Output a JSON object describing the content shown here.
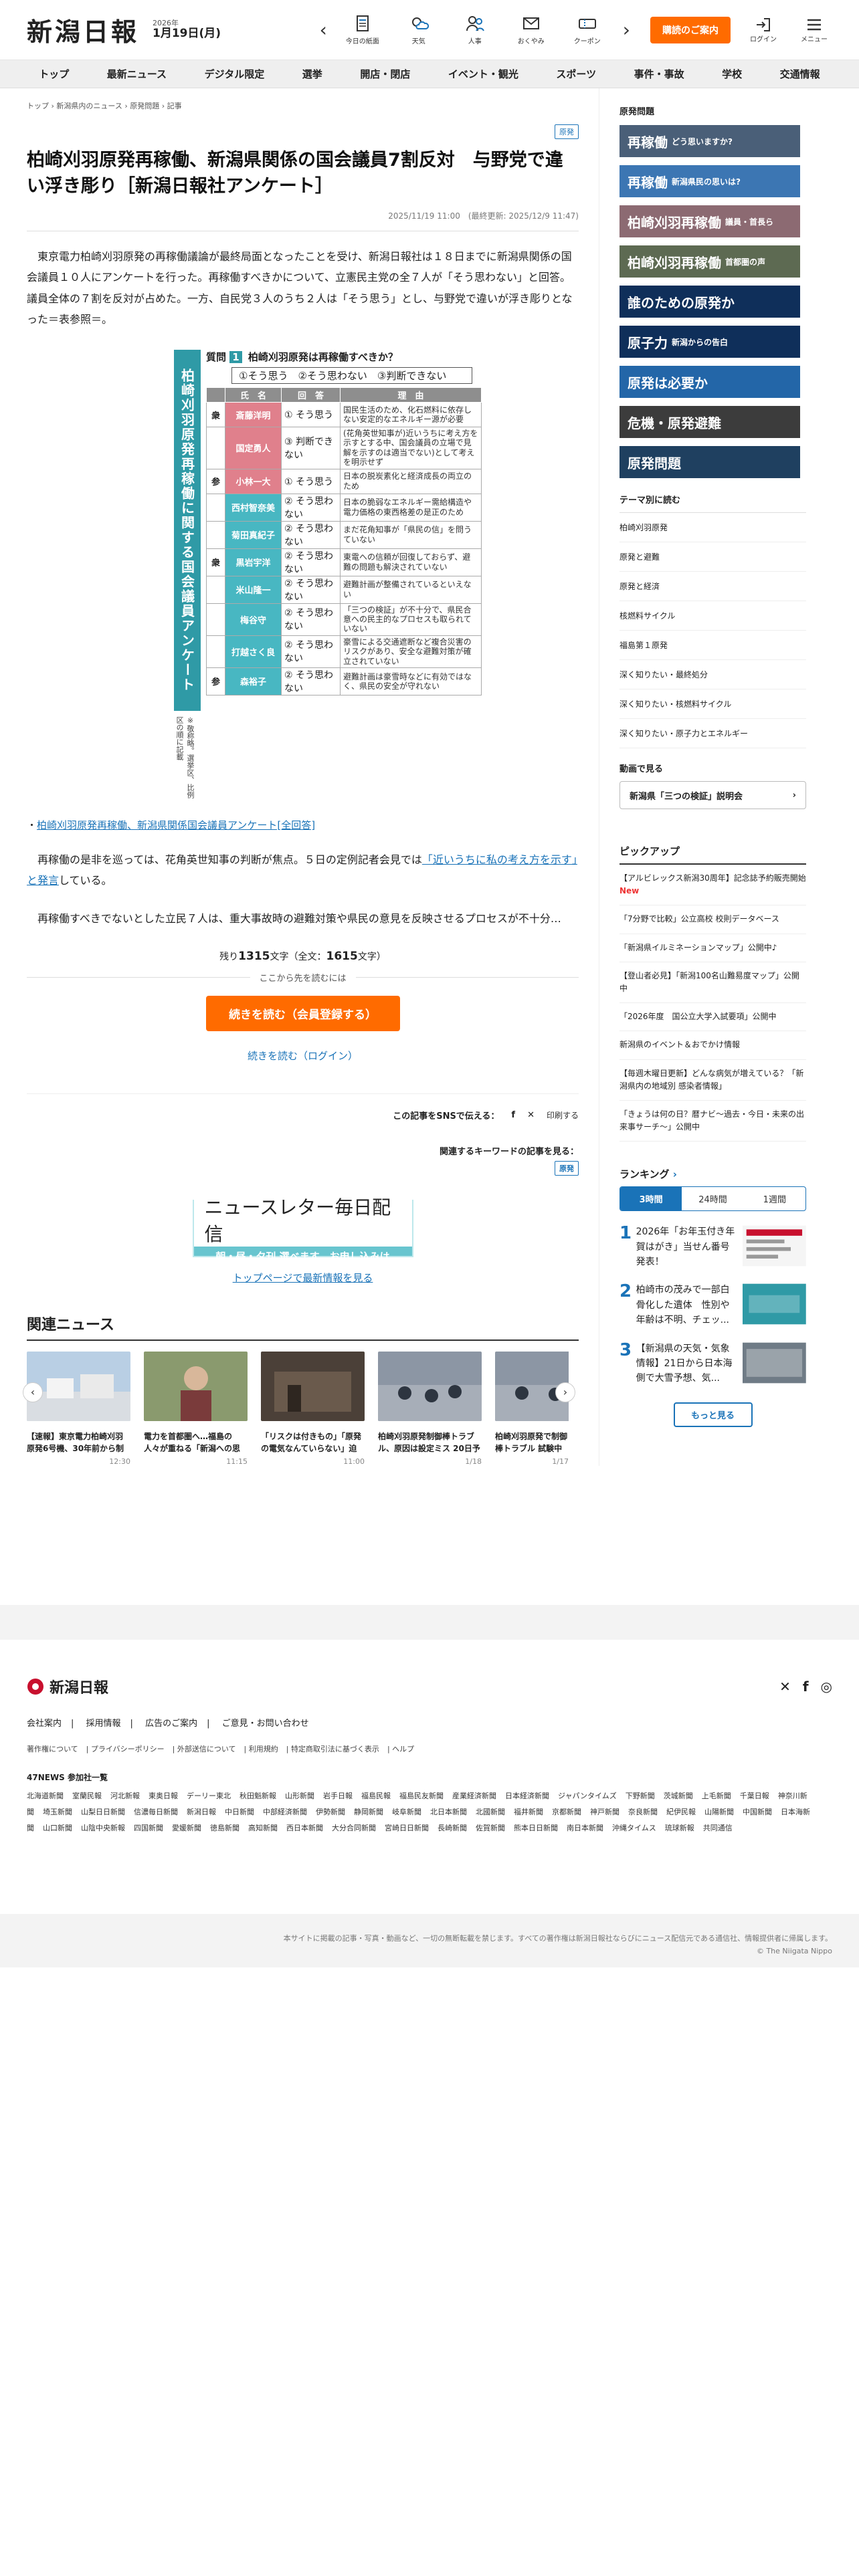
{
  "header": {
    "logo": "新潟日報",
    "year": "2026年",
    "date": "1月19日(月)",
    "icons": [
      "今日の紙面",
      "天気",
      "人事",
      "おくやみ",
      "クーポン"
    ],
    "subscribe": "購読のご案内",
    "login": "ログイン",
    "menu": "メニュー"
  },
  "nav": [
    "トップ",
    "最新ニュース",
    "デジタル限定",
    "選挙",
    "開店・閉店",
    "イベント・観光",
    "スポーツ",
    "事件・事故",
    "学校",
    "交通情報"
  ],
  "breadcrumb": "トップ › 新潟県内のニュース › 原発問題 › 記事",
  "article": {
    "tag": "原発",
    "headline": "柏崎刈羽原発再稼働、新潟県関係の国会議員7割反対　与野党で違い浮き彫り［新潟日報社アンケート］",
    "dateline": "2025/11/19 11:00　(最終更新: 2025/12/9 11:47)",
    "lead": "東京電力柏崎刈羽原発の再稼働議論が最終局面となったことを受け、新潟日報社は１８日までに新潟県関係の国会議員１０人にアンケートを行った。再稼働すべきかについて、立憲民主党の全７人が「そう思わない」と回答。議員全体の７割を反対が占めた。一方、自民党３人のうち２人は「そう思う」とし、与野党で違いが浮き彫りとなった＝表参照＝。",
    "figure": {
      "vertical_title": "柏崎刈羽原発再稼働に関する国会議員アンケート",
      "note": "※敬称略。選挙区、比例区の順に記載",
      "question_no": "1",
      "question": "柏崎刈羽原発は再稼働すべきか？",
      "options": "①そう思う　②そう思わない　③判断できない",
      "headers": [
        "氏　名",
        "回　答",
        "理　由"
      ],
      "rows": [
        {
          "party": "衆",
          "name": "斎藤洋明",
          "answer": "① そう思う",
          "reason": "国民生活のため、化石燃料に依存しない安定的なエネルギー源が必要"
        },
        {
          "party": "",
          "name": "国定勇人",
          "answer": "③ 判断できない",
          "reason": "(花角英世知事が)近いうちに考え方を示すとする中、国会議員の立場で見解を示すのは適当でない)として考えを明示せず"
        },
        {
          "party": "参",
          "name": "小林一大",
          "answer": "① そう思う",
          "reason": "日本の脱炭素化と経済成長の両立のため"
        },
        {
          "party": "",
          "name": "西村智奈美",
          "answer": "② そう思わない",
          "reason": "日本の脆弱なエネルギー需給構造や電力価格の東西格差の是正のため"
        },
        {
          "party": "",
          "name": "菊田真紀子",
          "answer": "② そう思わない",
          "reason": "まだ花角知事が「県民の信」を問うていない"
        },
        {
          "party": "衆",
          "name": "黒岩宇洋",
          "answer": "② そう思わない",
          "reason": "東電への信頼が回復しておらず、避難の問題も解決されていない"
        },
        {
          "party": "",
          "name": "米山隆一",
          "answer": "② そう思わない",
          "reason": "避難計画が整備されているといえない"
        },
        {
          "party": "",
          "name": "梅谷守",
          "answer": "② そう思わない",
          "reason": "「三つの検証」が不十分で、県民合意への民主的なプロセスも取られていない"
        },
        {
          "party": "",
          "name": "打越さく良",
          "answer": "② そう思わない",
          "reason": "豪雪による交通遮断など複合災害のリスクがあり、安全な避難対策が確立されていない"
        },
        {
          "party": "参",
          "name": "森裕子",
          "answer": "② そう思わない",
          "reason": "避難計画は豪雪時などに有効ではなく、県民の安全が守れない"
        }
      ]
    },
    "related_link": "柏崎刈羽原発再稼働、新潟県関係国会議員アンケート[全回答]",
    "para2_pre": "再稼働の是非を巡っては、花角英世知事の判断が焦点。５日の定例記者会見では",
    "para2_link": "「近いうちに私の考え方を示す」と発言",
    "para2_post": "している。",
    "para3": "再稼働すべきでないとした立民７人は、重大事故時の避難対策や県民の意見を反映させるプロセスが不十分…",
    "remain_prefix": "残り",
    "remain_count": "1315",
    "remain_unit": "文字（全文：",
    "total_count": "1615",
    "total_unit": "文字）",
    "continue_text": "ここから先を読むには",
    "btn_member": "続きを読む（会員登録する）",
    "btn_login": "続きを読む（ログイン）",
    "share_label": "この記事をSNSで伝える：",
    "print": "印刷する",
    "keyword_label": "関連するキーワードの記事を見る：",
    "keyword_tag": "原発",
    "newsletter_1": "ニュースレター毎日配信",
    "newsletter_2": "朝・昼・夕刊 選べます　お申し込みは",
    "toplink": "トップページで最新情報を見る"
  },
  "related": {
    "title": "関連ニュース",
    "items": [
      {
        "text": "【速報】東京電力柏崎刈羽原発6号機、30年前から制御棒の警報...",
        "time": "12:30"
      },
      {
        "text": "電力を首都圏へ…福島の人々が重ねる「新潟への思い」 原発事故...",
        "time": "11:15"
      },
      {
        "text": "「リスクは付きもの」「原発の電気なんていらない」迫る再稼働、...",
        "time": "11:00"
      },
      {
        "text": "柏崎刈羽原発制御棒トラブル、原因は設定ミス 20日予定の再稼...",
        "time": "1/18"
      },
      {
        "text": "柏崎刈羽原発で制御棒トラブル 試験中の警報鳴らず、原因不明 ...",
        "time": "1/17"
      }
    ]
  },
  "sidebar": {
    "issue_title": "原発問題",
    "banners": [
      {
        "main": "再稼働",
        "sub": "どう思いますか?"
      },
      {
        "main": "再稼働",
        "sub": "新潟県民の思いは?"
      },
      {
        "main": "柏崎刈羽再稼働",
        "sub": "議員・首長ら"
      },
      {
        "main": "柏崎刈羽再稼働",
        "sub": "首都圏の声"
      },
      {
        "main": "誰のための原発か",
        "sub": ""
      },
      {
        "main": "原子力",
        "sub": "新潟からの告白"
      },
      {
        "main": "原発は必要か",
        "sub": ""
      },
      {
        "main": "危機・原発避難",
        "sub": ""
      },
      {
        "main": "原発問題",
        "sub": ""
      }
    ],
    "theme_title": "テーマ別に読む",
    "themes": [
      "柏崎刈羽原発",
      "原発と避難",
      "原発と経済",
      "核燃料サイクル",
      "福島第１原発",
      "深く知りたい・最終処分",
      "深く知りたい・核燃料サイクル",
      "深く知りたい・原子力とエネルギー"
    ],
    "video_title": "動画で見る",
    "video_btn": "新潟県「三つの検証」説明会",
    "pick_title": "ピックアップ",
    "picks": [
      {
        "text": "【アルビレックス新潟30周年】記念誌予約販売開始",
        "new": "New"
      },
      {
        "text": "「7分野で比較」公立高校 校則データベース",
        "new": ""
      },
      {
        "text": "「新潟県イルミネーションマップ」公開中♪",
        "new": ""
      },
      {
        "text": "【登山者必見】「新潟100名山難易度マップ」公開中",
        "new": ""
      },
      {
        "text": "「2026年度　国公立大学入試要項」公開中",
        "new": ""
      },
      {
        "text": "新潟県のイベント＆おでかけ情報",
        "new": ""
      },
      {
        "text": "【毎週木曜日更新】どんな病気が増えている？「新潟県内の地域別 感染者情報」",
        "new": ""
      },
      {
        "text": "「きょうは何の日？暦ナビ〜過去・今日・未来の出来事サーチ〜」公開中",
        "new": ""
      }
    ],
    "rank_title": "ランキング",
    "rank_tabs": [
      "3時間",
      "24時間",
      "1週間"
    ],
    "rankings": [
      {
        "no": "1",
        "text": "2026年「お年玉付き年賀はがき」当せん番号発表！"
      },
      {
        "no": "2",
        "text": "柏崎市の茂みで一部白骨化した遺体　性別や年齢は不明、チェッ..."
      },
      {
        "no": "3",
        "text": "【新潟県の天気・気象情報】21日から日本海側で大雪予想、気..."
      }
    ],
    "more": "もっと見る"
  },
  "footer": {
    "logo": "新潟日報",
    "links": [
      "会社案内",
      "採用情報",
      "広告のご案内",
      "ご意見・お問い合わせ"
    ],
    "links2": [
      "著作権について",
      "プライバシーポリシー",
      "外部送信について",
      "利用規約",
      "特定商取引法に基づく表示",
      "ヘルプ"
    ],
    "news47": "47NEWS 参加社一覧",
    "papers": [
      "北海道新聞",
      "室蘭民報",
      "河北新報",
      "東奥日報",
      "デーリー東北",
      "秋田魁新報",
      "山形新聞",
      "岩手日報",
      "福島民報",
      "福島民友新聞",
      "産業経済新聞",
      "日本経済新聞",
      "ジャパンタイムズ",
      "下野新聞",
      "茨城新聞",
      "上毛新聞",
      "千葉日報",
      "神奈川新聞",
      "埼玉新聞",
      "山梨日日新聞",
      "信濃毎日新聞",
      "新潟日報",
      "中日新聞",
      "中部経済新聞",
      "伊勢新聞",
      "静岡新聞",
      "岐阜新聞",
      "北日本新聞",
      "北國新聞",
      "福井新聞",
      "京都新聞",
      "神戸新聞",
      "奈良新聞",
      "紀伊民報",
      "山陽新聞",
      "中国新聞",
      "日本海新聞",
      "山口新聞",
      "山陰中央新報",
      "四国新聞",
      "愛媛新聞",
      "徳島新聞",
      "高知新聞",
      "西日本新聞",
      "大分合同新聞",
      "宮崎日日新聞",
      "長崎新聞",
      "佐賀新聞",
      "熊本日日新聞",
      "南日本新聞",
      "沖縄タイムス",
      "琉球新報",
      "共同通信"
    ],
    "copyright1": "本サイトに掲載の記事・写真・動画など、一切の無断転載を禁じます。すべての著作権は新潟日報社ならびにニュース配信元である通信社、情報提供者に帰属します。",
    "copyright2": "© The Niigata Nippo"
  },
  "colors": {
    "accent_orange": "#ff6b00",
    "link_blue": "#1a73b8",
    "figure_teal": "#2f9aa6",
    "ldp_pink": "#e0808c",
    "cdp_teal": "#48b7c2"
  }
}
